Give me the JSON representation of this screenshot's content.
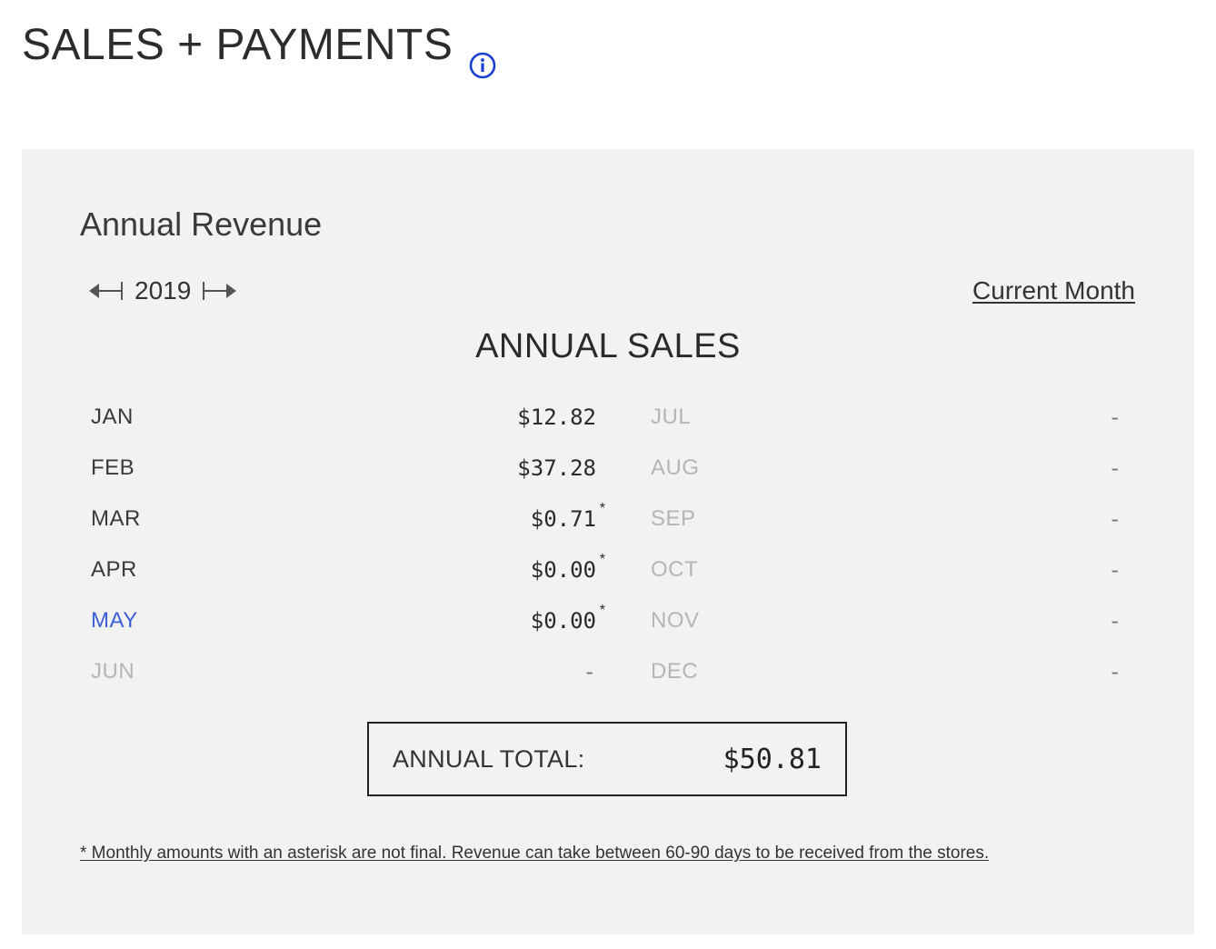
{
  "header": {
    "title": "SALES + PAYMENTS",
    "info_icon": "info-circle-icon",
    "accent_color": "#1a3fd4"
  },
  "panel": {
    "title": "Annual Revenue",
    "year": "2019",
    "current_month_link": "Current Month",
    "heading": "ANNUAL SALES",
    "months_left": [
      {
        "name": "JAN",
        "value": "$12.82",
        "asterisk": "",
        "state": "past"
      },
      {
        "name": "FEB",
        "value": "$37.28",
        "asterisk": "",
        "state": "past"
      },
      {
        "name": "MAR",
        "value": "$0.71",
        "asterisk": "*",
        "state": "past"
      },
      {
        "name": "APR",
        "value": "$0.00",
        "asterisk": "*",
        "state": "past"
      },
      {
        "name": "MAY",
        "value": "$0.00",
        "asterisk": "*",
        "state": "current"
      },
      {
        "name": "JUN",
        "value": "-",
        "asterisk": "",
        "state": "future"
      }
    ],
    "months_right": [
      {
        "name": "JUL",
        "value": "-",
        "asterisk": "",
        "state": "future"
      },
      {
        "name": "AUG",
        "value": "-",
        "asterisk": "",
        "state": "future"
      },
      {
        "name": "SEP",
        "value": "-",
        "asterisk": "",
        "state": "future"
      },
      {
        "name": "OCT",
        "value": "-",
        "asterisk": "",
        "state": "future"
      },
      {
        "name": "NOV",
        "value": "-",
        "asterisk": "",
        "state": "future"
      },
      {
        "name": "DEC",
        "value": "-",
        "asterisk": "",
        "state": "future"
      }
    ],
    "total_label": "ANNUAL TOTAL:",
    "total_value": "$50.81",
    "footnote": "* Monthly amounts with an asterisk are not final. Revenue can take between 60-90 days to be received from the stores."
  }
}
